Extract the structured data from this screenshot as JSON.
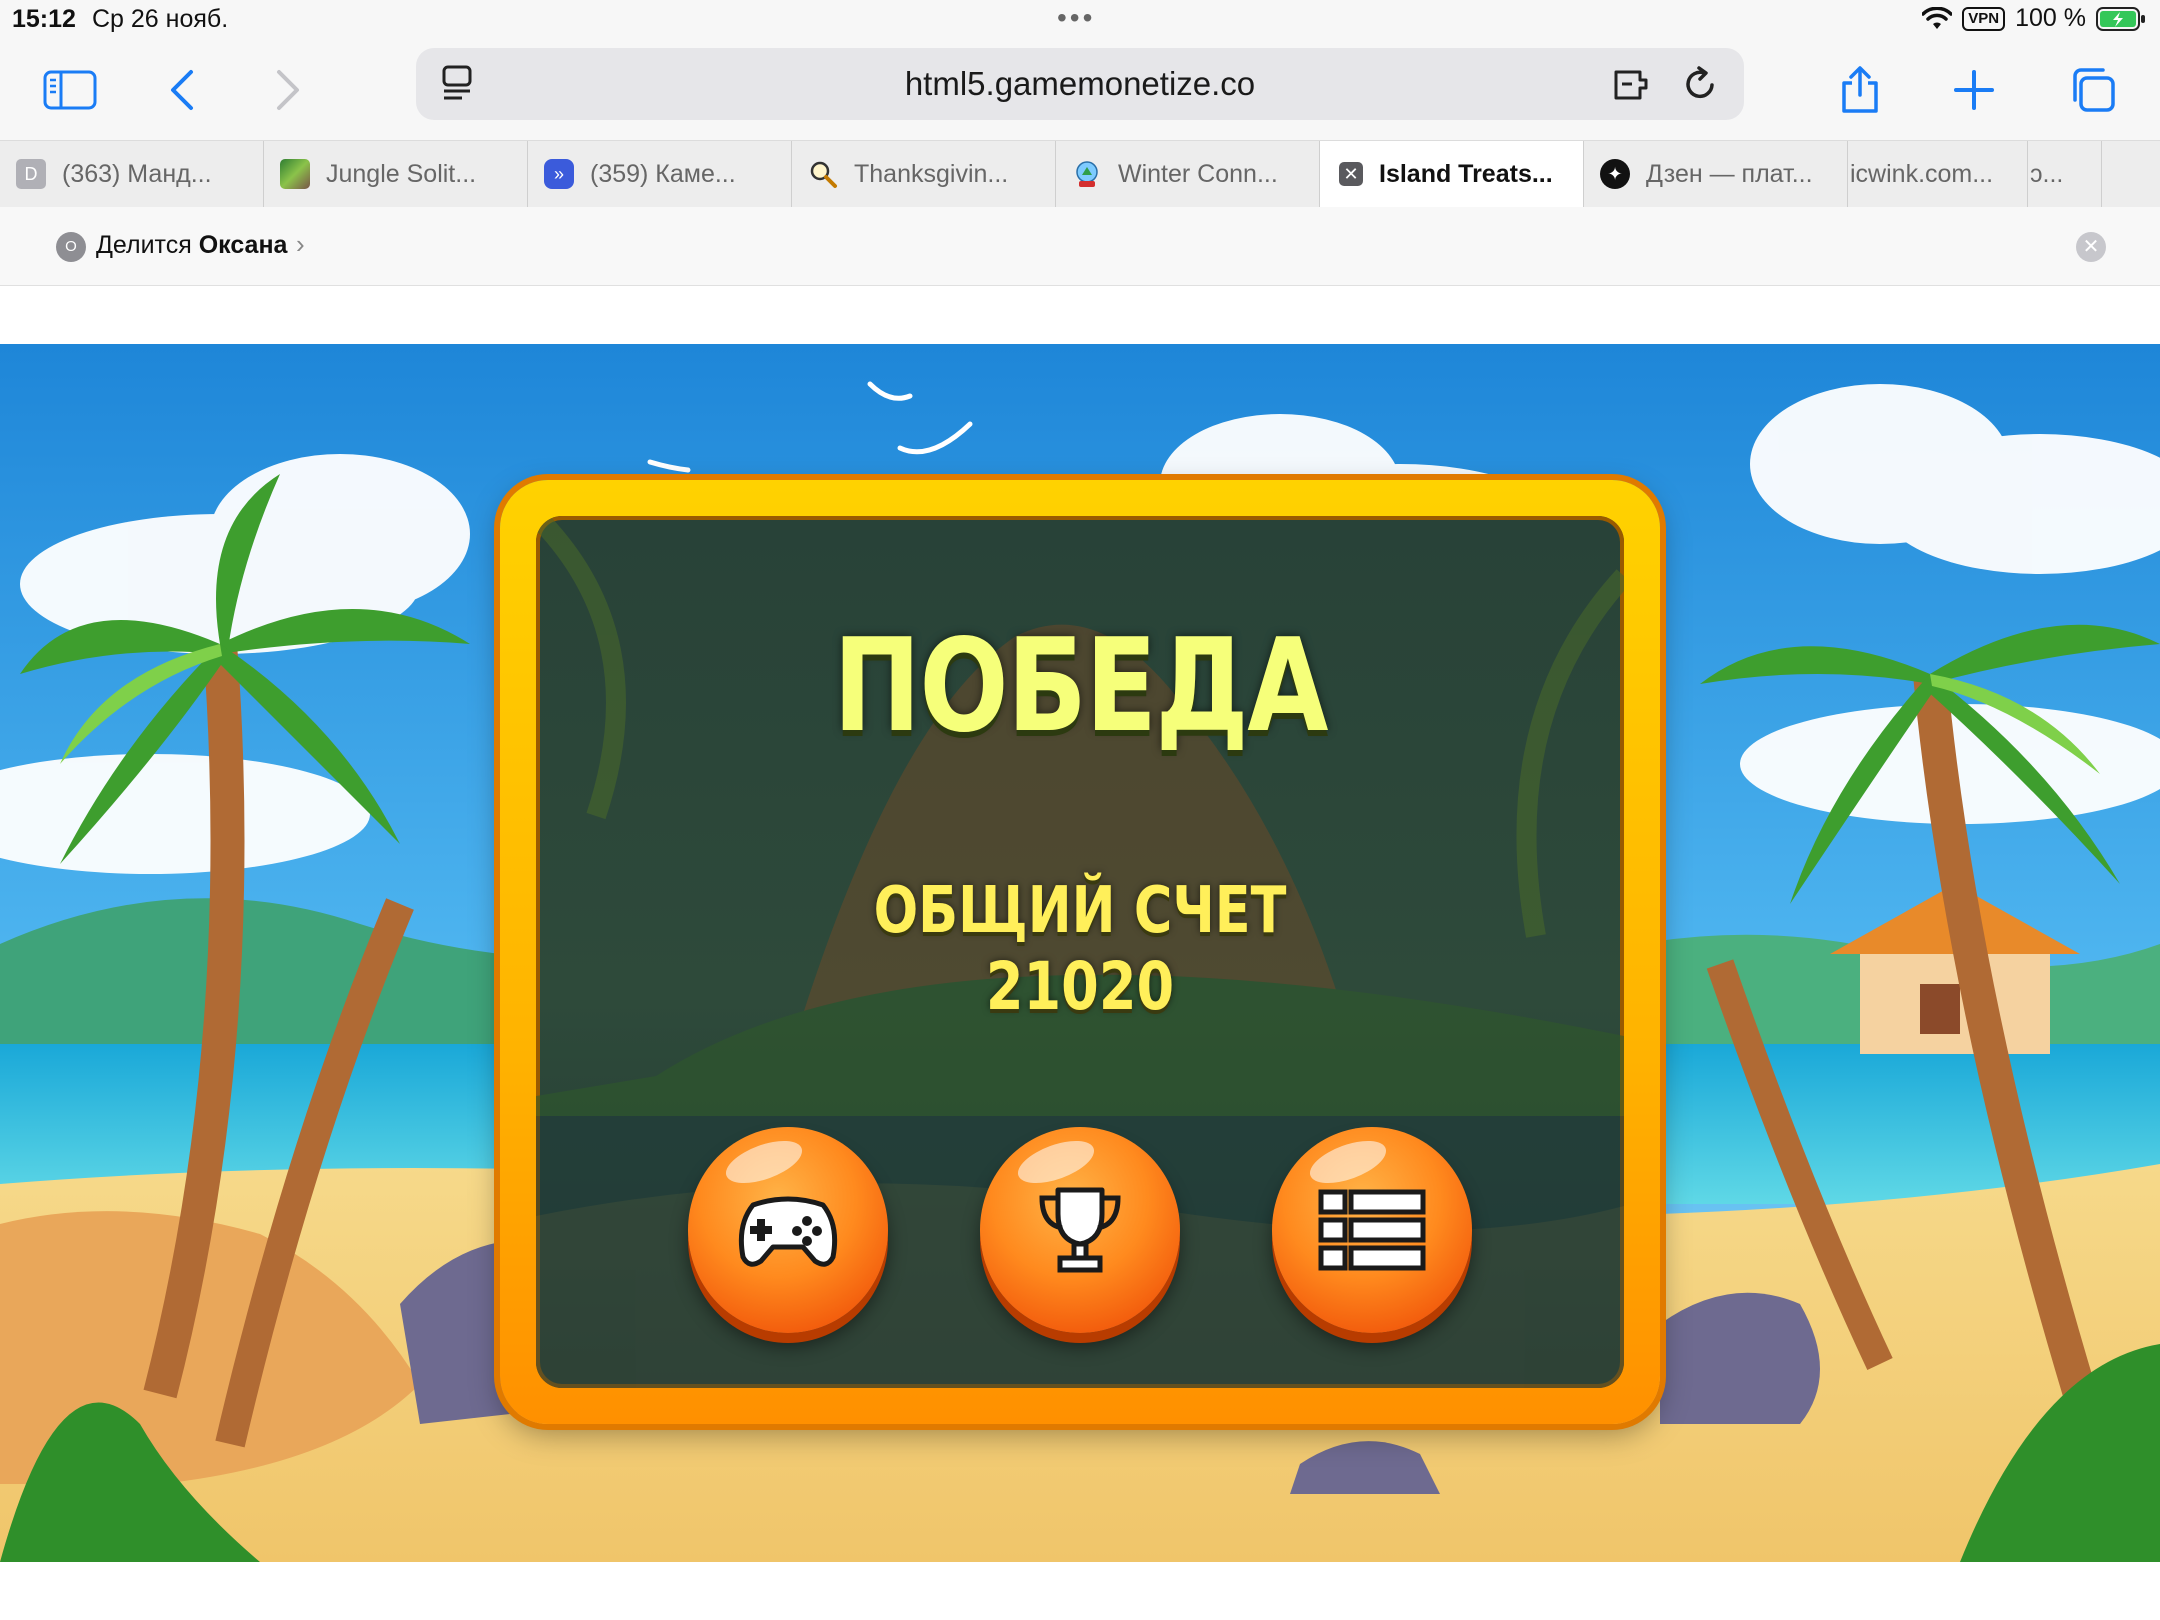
{
  "status_bar": {
    "time": "15:12",
    "date": "Ср 26 нояб.",
    "vpn": "VPN",
    "battery_percent": "100 %"
  },
  "toolbar": {
    "url": "html5.gamemonetize.co",
    "icons": [
      "sidebar-icon",
      "back-icon",
      "forward-icon",
      "reader-icon",
      "extension-icon",
      "reload-icon",
      "share-icon",
      "new-tab-icon",
      "tabs-overview-icon"
    ]
  },
  "tabs": [
    {
      "label": "(363) Манд...",
      "favicon": "D"
    },
    {
      "label": "Jungle Solit...",
      "favicon": ""
    },
    {
      "label": "(359) Каме...",
      "favicon": ""
    },
    {
      "label": "Thanksgivin...",
      "favicon": ""
    },
    {
      "label": "Winter Conn...",
      "favicon": ""
    },
    {
      "label": "Island Treats...",
      "favicon": "",
      "active": true
    },
    {
      "label": "Дзен — плат...",
      "favicon": ""
    },
    {
      "label": "icwink.com...",
      "favicon": ""
    },
    {
      "label": "ɔ...",
      "favicon": ""
    }
  ],
  "share_bar": {
    "avatar_initial": "O",
    "prefix": "Делится",
    "name": "Оксана"
  },
  "game": {
    "title": "ПОБЕДА",
    "score_label": "ОБЩИЙ СЧЕТ",
    "score_value": "21020",
    "buttons": [
      {
        "name": "play",
        "icon": "gamepad-icon"
      },
      {
        "name": "leaderboard",
        "icon": "trophy-icon"
      },
      {
        "name": "menu",
        "icon": "list-icon"
      }
    ]
  },
  "colors": {
    "accent_blue": "#1a7cf5",
    "panel_gold": "#ffb300",
    "title_yellow": "#f6ff7a",
    "button_orange": "#ff8a1e"
  }
}
